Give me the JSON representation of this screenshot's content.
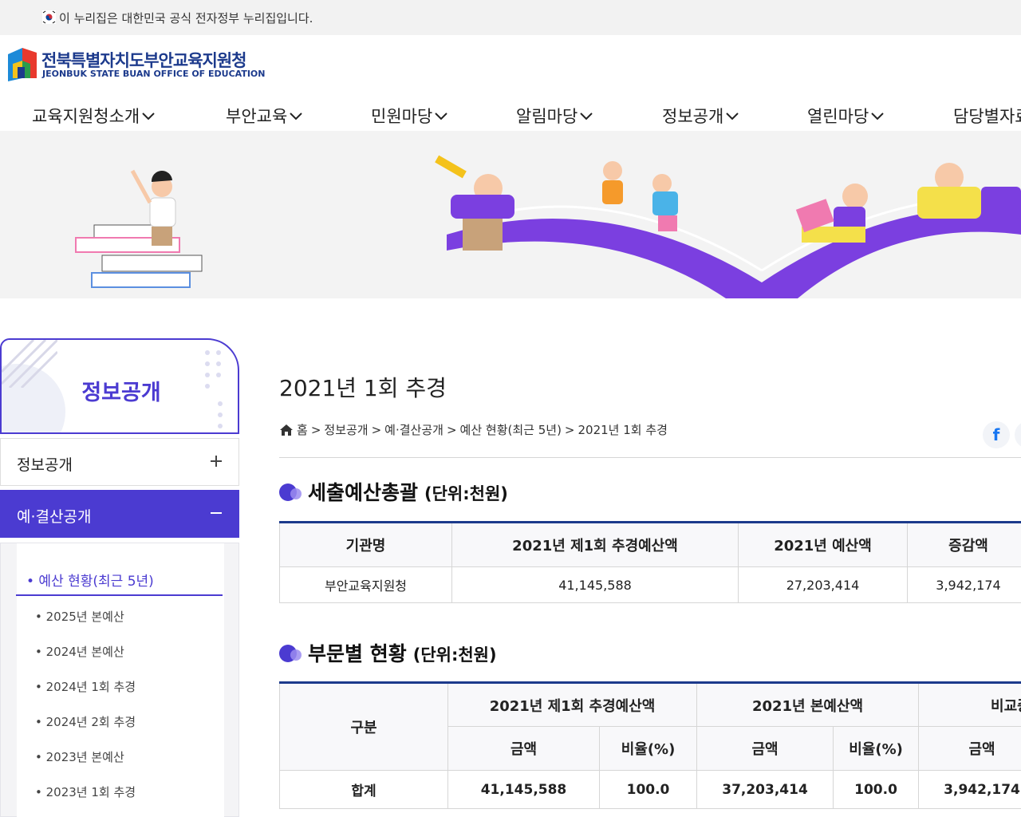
{
  "gov_notice": "이 누리집은 대한민국 공식 전자정부 누리집입니다.",
  "logo": {
    "name": "전북특별자치도부안교육지원청",
    "eng": "JEONBUK STATE BUAN OFFICE OF EDUCATION"
  },
  "gnb": [
    "교육지원청소개",
    "부안교육",
    "민원마당",
    "알림마당",
    "정보공개",
    "열린마당",
    "담당별자료"
  ],
  "side": {
    "title": "정보공개",
    "menu": [
      {
        "label": "정보공개",
        "state": "collapsed"
      },
      {
        "label": "예·결산공개",
        "state": "expanded"
      }
    ],
    "current": "• 예산 현황(최근 5년)",
    "sub": [
      "2025년 본예산",
      "2024년 본예산",
      "2024년 1회 추경",
      "2024년 2회 추경",
      "2023년 본예산",
      "2023년 1회 추경"
    ]
  },
  "page": {
    "title": "2021년 1회 추경",
    "breadcrumb": [
      "홈",
      "정보공개",
      "예·결산공개",
      "예산 현황(최근 5년)",
      "2021년 1회 추경"
    ],
    "facebook_icon": "f"
  },
  "section1": {
    "title": "세출예산총괄",
    "unit": "(단위:천원)",
    "headers": [
      "기관명",
      "2021년 제1회 추경예산액",
      "2021년 예산액",
      "증감액"
    ],
    "row": [
      "부안교육지원청",
      "41,145,588",
      "27,203,414",
      "3,942,174"
    ]
  },
  "section2": {
    "title": "부문별 현황",
    "unit": "(단위:천원)",
    "group_headers": [
      "구분",
      "2021년 제1회 추경예산액",
      "2021년 본예산액",
      "비교증감"
    ],
    "sub_headers": [
      "금액",
      "비율(%)",
      "금액",
      "비율(%)",
      "금액"
    ],
    "row": [
      "합계",
      "41,145,588",
      "100.0",
      "37,203,414",
      "100.0",
      "3,942,174"
    ]
  },
  "colors": {
    "brand": "#4b3bd1",
    "navy": "#1c3a8c"
  }
}
